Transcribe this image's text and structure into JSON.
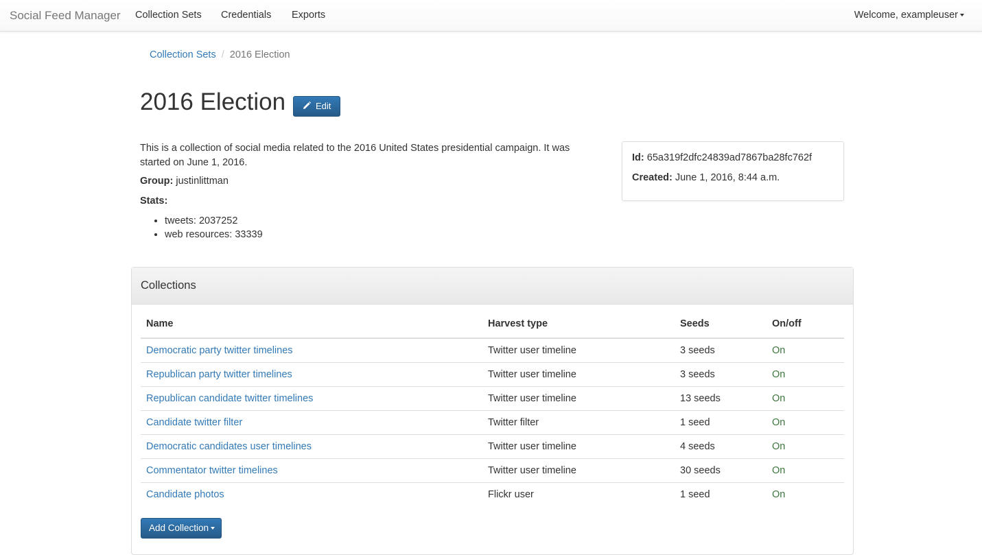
{
  "navbar": {
    "brand": "Social Feed Manager",
    "links": [
      "Collection Sets",
      "Credentials",
      "Exports"
    ],
    "welcome": "Welcome, exampleuser"
  },
  "breadcrumb": {
    "parent": "Collection Sets",
    "current": "2016 Election"
  },
  "page": {
    "title": "2016 Election",
    "edit_label": "Edit",
    "description": "This is a collection of social media related to the 2016 United States presidential campaign. It was started on June 1, 2016.",
    "group_label": "Group:",
    "group_value": "justinlittman",
    "stats_label": "Stats:",
    "stats": [
      "tweets: 2037252",
      "web resources: 33339"
    ]
  },
  "info": {
    "id_label": "Id:",
    "id_value": "65a319f2dfc24839ad7867ba28fc762f",
    "created_label": "Created:",
    "created_value": "June 1, 2016, 8:44 a.m."
  },
  "collections": {
    "heading": "Collections",
    "columns": [
      "Name",
      "Harvest type",
      "Seeds",
      "On/off"
    ],
    "rows": [
      {
        "name": "Democratic party twitter timelines",
        "type": "Twitter user timeline",
        "seeds": "3 seeds",
        "status": "On"
      },
      {
        "name": "Republican party twitter timelines",
        "type": "Twitter user timeline",
        "seeds": "3 seeds",
        "status": "On"
      },
      {
        "name": "Republican candidate twitter timelines",
        "type": "Twitter user timeline",
        "seeds": "13 seeds",
        "status": "On"
      },
      {
        "name": "Candidate twitter filter",
        "type": "Twitter filter",
        "seeds": "1 seed",
        "status": "On"
      },
      {
        "name": "Democratic candidates user timelines",
        "type": "Twitter user timeline",
        "seeds": "4 seeds",
        "status": "On"
      },
      {
        "name": "Commentator twitter timelines",
        "type": "Twitter user timeline",
        "seeds": "30 seeds",
        "status": "On"
      },
      {
        "name": "Candidate photos",
        "type": "Flickr user",
        "seeds": "1 seed",
        "status": "On"
      }
    ],
    "add_label": "Add Collection"
  },
  "colors": {
    "link": "#337ab7",
    "primary": "#2e6da4",
    "on_status": "#3c763d"
  }
}
